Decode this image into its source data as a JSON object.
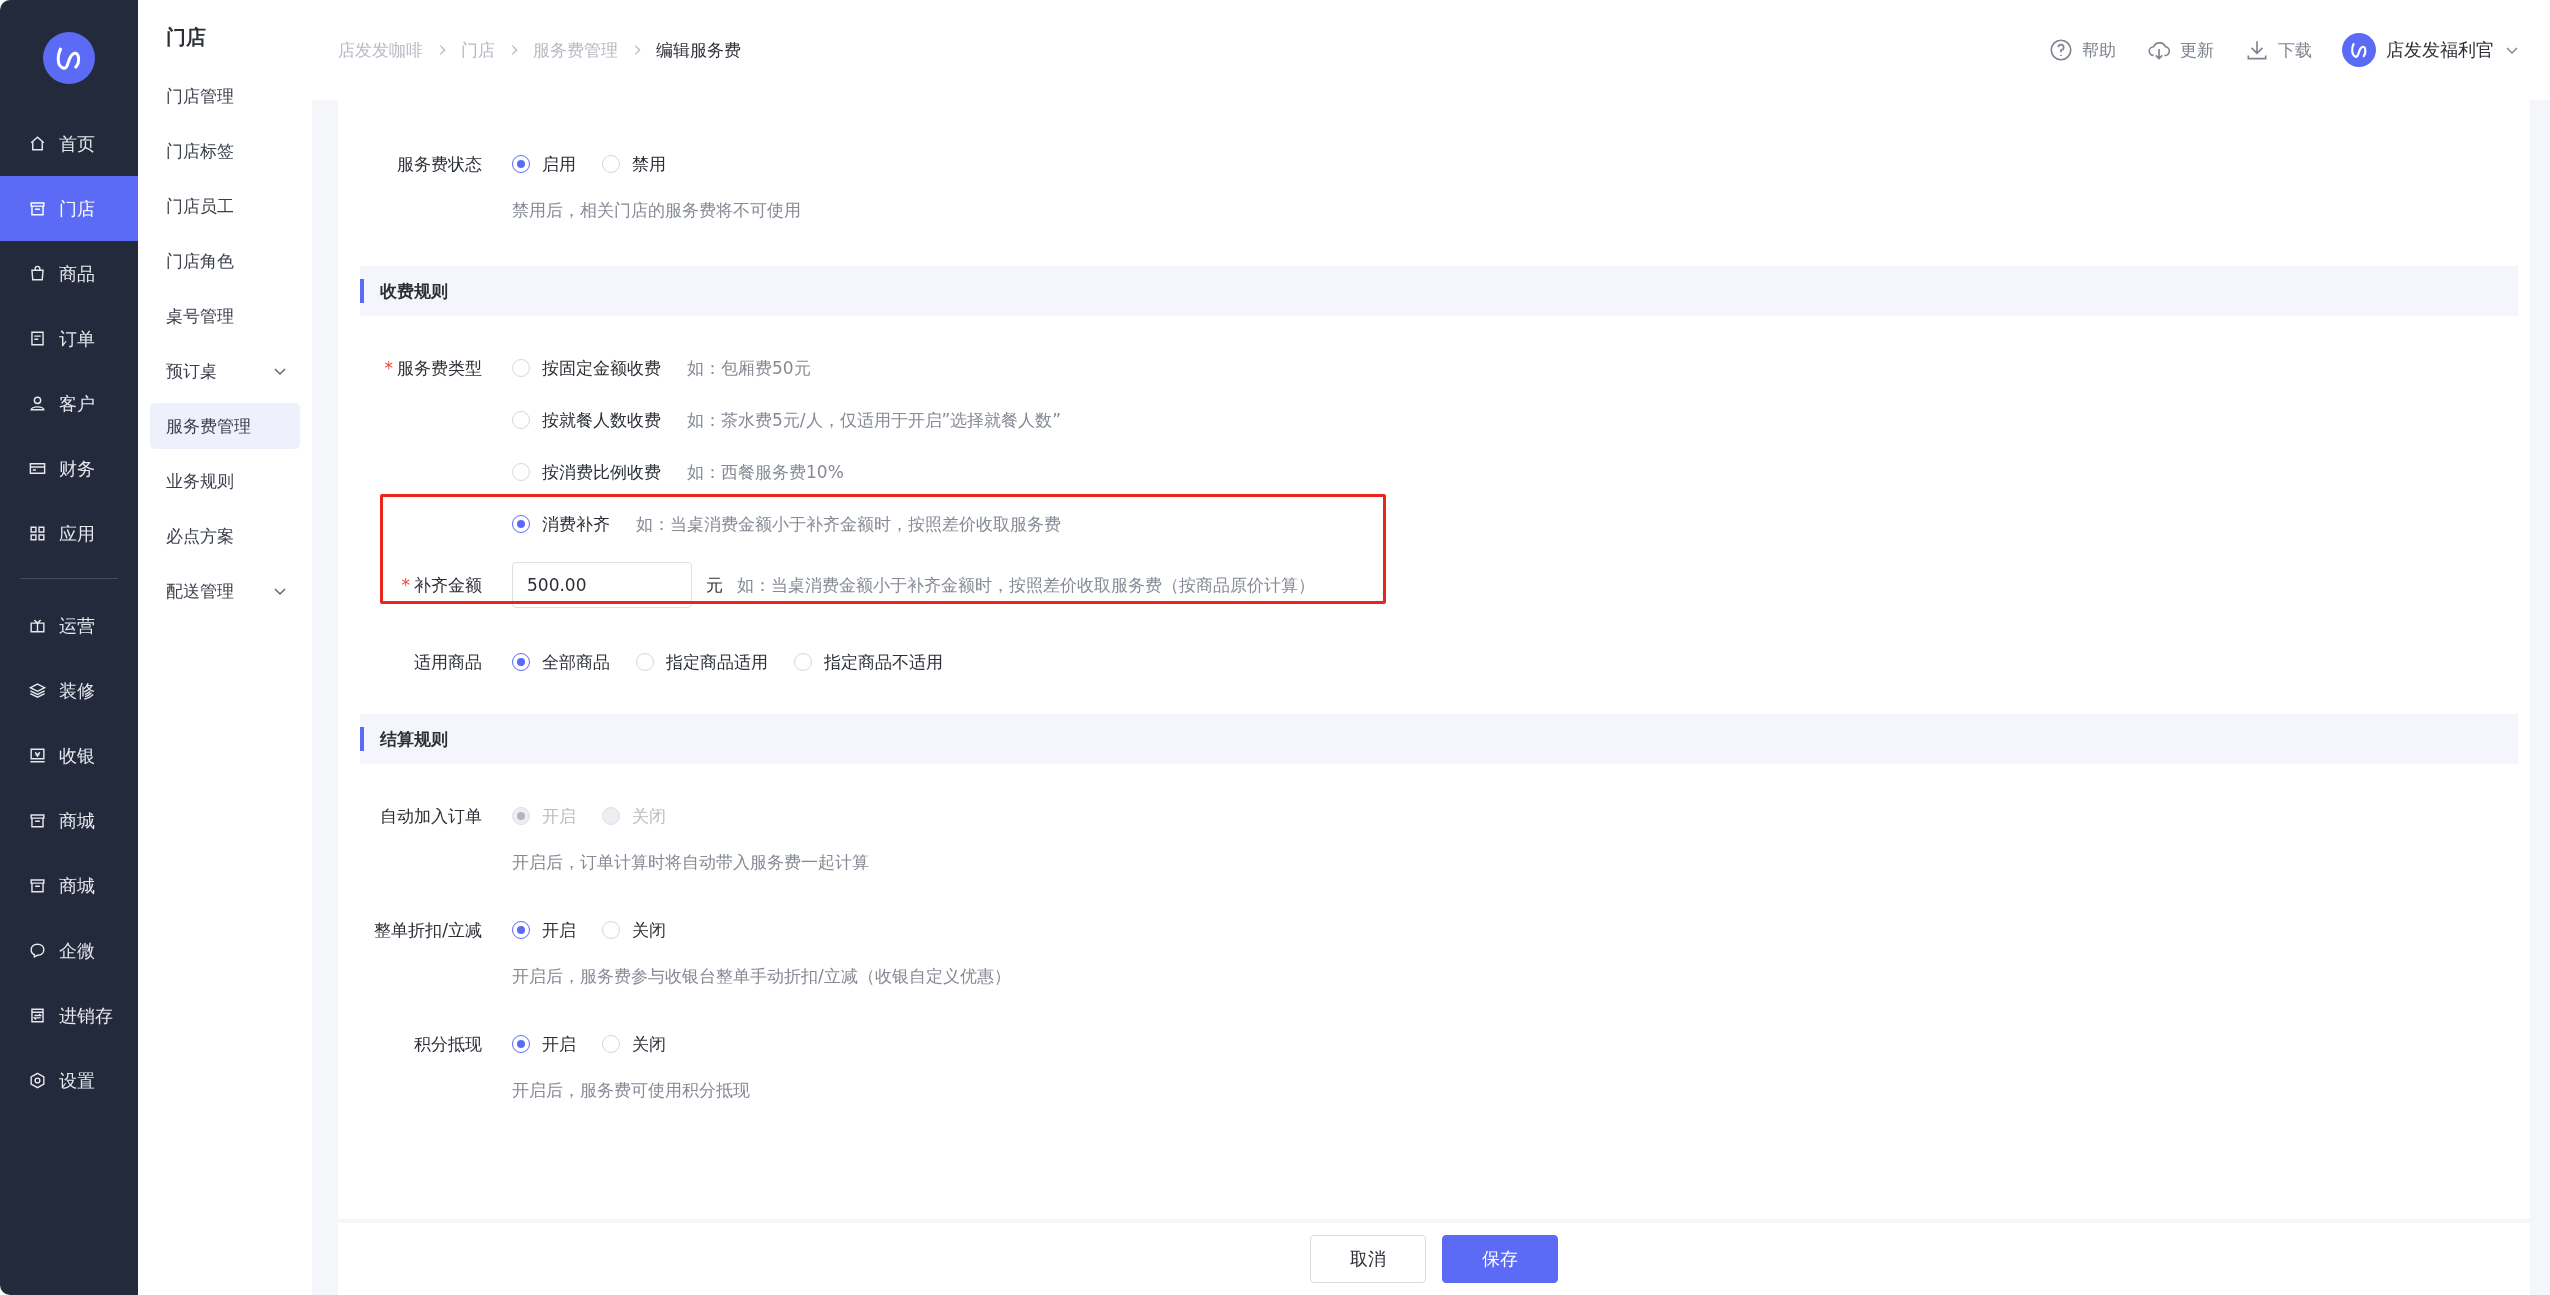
{
  "nav": {
    "groups": [
      [
        {
          "label": "首页",
          "selected": false
        },
        {
          "label": "门店",
          "selected": true
        },
        {
          "label": "商品",
          "selected": false
        },
        {
          "label": "订单",
          "selected": false
        },
        {
          "label": "客户",
          "selected": false
        },
        {
          "label": "财务",
          "selected": false
        },
        {
          "label": "应用",
          "selected": false
        }
      ],
      [
        {
          "label": "运营",
          "selected": false
        },
        {
          "label": "装修",
          "selected": false
        },
        {
          "label": "收银",
          "selected": false
        },
        {
          "label": "商城",
          "selected": false
        },
        {
          "label": "商城",
          "selected": false
        },
        {
          "label": "企微",
          "selected": false
        },
        {
          "label": "进销存",
          "selected": false
        },
        {
          "label": "设置",
          "selected": false
        }
      ]
    ]
  },
  "submenu": {
    "title": "门店",
    "items": [
      {
        "label": "门店管理",
        "selected": false,
        "kind": "link"
      },
      {
        "label": "门店标签",
        "selected": false,
        "kind": "link"
      },
      {
        "label": "门店员工",
        "selected": false,
        "kind": "link"
      },
      {
        "label": "门店角色",
        "selected": false,
        "kind": "link"
      },
      {
        "label": "桌号管理",
        "selected": false,
        "kind": "link"
      },
      {
        "label": "预订桌",
        "selected": false,
        "kind": "group"
      },
      {
        "label": "服务费管理",
        "selected": true,
        "kind": "link"
      },
      {
        "label": "业务规则",
        "selected": false,
        "kind": "link"
      },
      {
        "label": "必点方案",
        "selected": false,
        "kind": "link"
      },
      {
        "label": "配送管理",
        "selected": false,
        "kind": "group"
      }
    ]
  },
  "breadcrumbs": [
    "店发发咖啡",
    "门店",
    "服务费管理",
    "编辑服务费"
  ],
  "topbar": {
    "actions": [
      {
        "label": "帮助",
        "kind": "help"
      },
      {
        "label": "更新",
        "kind": "cloud"
      },
      {
        "label": "下载",
        "kind": "download"
      }
    ],
    "user": "店发发福利官"
  },
  "status": {
    "label": "服务费状态",
    "options": [
      {
        "label": "启用",
        "selected": true
      },
      {
        "label": "禁用",
        "selected": false
      }
    ],
    "hint": "禁用后，相关门店的服务费将不可使用"
  },
  "section_fee": {
    "title": "收费规则"
  },
  "fee_type": {
    "label": "服务费类型",
    "required_mark": "*",
    "options": [
      {
        "label": "按固定金额收费",
        "example": "如：包厢费50元",
        "selected": false
      },
      {
        "label": "按就餐人数收费",
        "example": "如：茶水费5元/人，仅适用于开启”选择就餐人数”",
        "selected": false
      },
      {
        "label": "按消费比例收费",
        "example": "如：西餐服务费10%",
        "selected": false
      },
      {
        "label": "消费补齐",
        "example": "如：当桌消费金额小于补齐金额时，按照差价收取服务费",
        "selected": true
      }
    ]
  },
  "top_up": {
    "label": "补齐金额",
    "required_mark": "*",
    "value": "500.00",
    "unit": "元",
    "hint": "如：当桌消费金额小于补齐金额时，按照差价收取服务费（按商品原价计算）"
  },
  "goods": {
    "label": "适用商品",
    "options": [
      {
        "label": "全部商品",
        "selected": true
      },
      {
        "label": "指定商品适用",
        "selected": false
      },
      {
        "label": "指定商品不适用",
        "selected": false
      }
    ]
  },
  "section_settle": {
    "title": "结算规则"
  },
  "settle_rules": [
    {
      "label": "自动加入订单",
      "disabled": true,
      "options": [
        {
          "label": "开启",
          "selected": true
        },
        {
          "label": "关闭",
          "selected": false
        }
      ],
      "hint": "开启后，订单计算时将自动带入服务费一起计算"
    },
    {
      "label": "整单折扣/立减",
      "disabled": false,
      "options": [
        {
          "label": "开启",
          "selected": true
        },
        {
          "label": "关闭",
          "selected": false
        }
      ],
      "hint": "开启后，服务费参与收银台整单手动折扣/立减（收银自定义优惠）"
    },
    {
      "label": "积分抵现",
      "disabled": false,
      "options": [
        {
          "label": "开启",
          "selected": true
        },
        {
          "label": "关闭",
          "selected": false
        }
      ],
      "hint": "开启后，服务费可使用积分抵现"
    }
  ],
  "footer": {
    "buttons": [
      {
        "label": "取消",
        "kind": "secondary"
      },
      {
        "label": "保存",
        "kind": "primary"
      }
    ]
  }
}
